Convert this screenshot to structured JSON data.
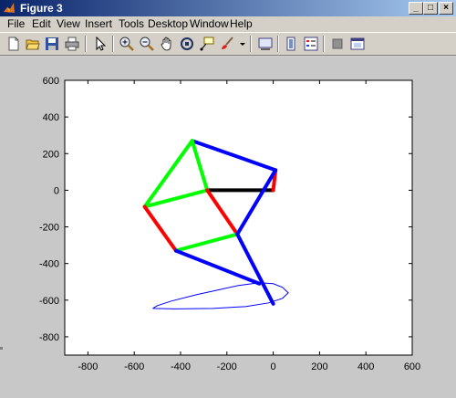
{
  "window": {
    "title": "Figure 3"
  },
  "window_controls": {
    "minimize": "_",
    "maximize": "□",
    "close": "×"
  },
  "menu": [
    "File",
    "Edit",
    "View",
    "Insert",
    "Tools",
    "Desktop",
    "Window",
    "Help"
  ],
  "toolbar": {
    "buttons": [
      {
        "name": "new-figure-icon"
      },
      {
        "name": "open-file-icon"
      },
      {
        "name": "save-icon"
      },
      {
        "name": "print-icon"
      },
      {
        "name": "edit-plot-arrow-icon"
      },
      {
        "name": "zoom-in-icon"
      },
      {
        "name": "zoom-out-icon"
      },
      {
        "name": "pan-hand-icon"
      },
      {
        "name": "rotate-3d-icon"
      },
      {
        "name": "data-cursor-icon"
      },
      {
        "name": "brush-icon"
      },
      {
        "name": "brush-dropdown-icon"
      },
      {
        "name": "link-plot-icon"
      },
      {
        "name": "colorbar-icon"
      },
      {
        "name": "legend-icon"
      },
      {
        "name": "hide-plot-tools-icon"
      },
      {
        "name": "show-plot-tools-icon"
      }
    ]
  },
  "chart_data": {
    "type": "line",
    "title": "",
    "xlabel": "",
    "ylabel": "",
    "xlim": [
      -900,
      600
    ],
    "ylim": [
      -900,
      600
    ],
    "xticks": [
      -800,
      -600,
      -400,
      -200,
      0,
      200,
      400,
      600
    ],
    "yticks": [
      600,
      400,
      200,
      0,
      -200,
      -400,
      -600,
      -800
    ],
    "grid": false,
    "segments": [
      {
        "color": "#000000",
        "points": [
          [
            -285,
            0
          ],
          [
            0,
            0
          ]
        ]
      },
      {
        "color": "#ff0000",
        "points": [
          [
            0,
            0
          ],
          [
            10,
            110
          ]
        ]
      },
      {
        "color": "#0000ff",
        "points": [
          [
            10,
            110
          ],
          [
            -350,
            270
          ]
        ]
      },
      {
        "color": "#00ff00",
        "points": [
          [
            -350,
            270
          ],
          [
            -285,
            0
          ]
        ]
      },
      {
        "color": "#00ff00",
        "points": [
          [
            -350,
            270
          ],
          [
            -555,
            -90
          ]
        ]
      },
      {
        "color": "#00ff00",
        "points": [
          [
            -555,
            -90
          ],
          [
            -285,
            0
          ]
        ]
      },
      {
        "color": "#ff0000",
        "points": [
          [
            -285,
            0
          ],
          [
            -155,
            -240
          ]
        ]
      },
      {
        "color": "#ff0000",
        "points": [
          [
            -555,
            -90
          ],
          [
            -420,
            -330
          ]
        ]
      },
      {
        "color": "#00ff00",
        "points": [
          [
            -420,
            -330
          ],
          [
            -155,
            -240
          ]
        ]
      },
      {
        "color": "#0000ff",
        "points": [
          [
            10,
            110
          ],
          [
            -155,
            -240
          ]
        ]
      },
      {
        "color": "#0000ff",
        "points": [
          [
            -155,
            -240
          ],
          [
            0,
            -620
          ]
        ]
      },
      {
        "color": "#0000ff",
        "points": [
          [
            -420,
            -330
          ],
          [
            -60,
            -510
          ]
        ]
      }
    ],
    "curve": {
      "color": "#0000ff",
      "points": [
        [
          -520,
          -645
        ],
        [
          -500,
          -630
        ],
        [
          -440,
          -605
        ],
        [
          -330,
          -570
        ],
        [
          -240,
          -545
        ],
        [
          -150,
          -520
        ],
        [
          -60,
          -505
        ],
        [
          0,
          -510
        ],
        [
          40,
          -530
        ],
        [
          65,
          -560
        ],
        [
          40,
          -590
        ],
        [
          -20,
          -615
        ],
        [
          -120,
          -635
        ],
        [
          -260,
          -645
        ],
        [
          -420,
          -648
        ],
        [
          -520,
          -645
        ]
      ]
    }
  },
  "colors": {
    "titlebar_start": "#0a246a",
    "titlebar_end": "#a6caf0",
    "figure_bg": "#c8c8c8",
    "axes_bg": "#ffffff"
  }
}
